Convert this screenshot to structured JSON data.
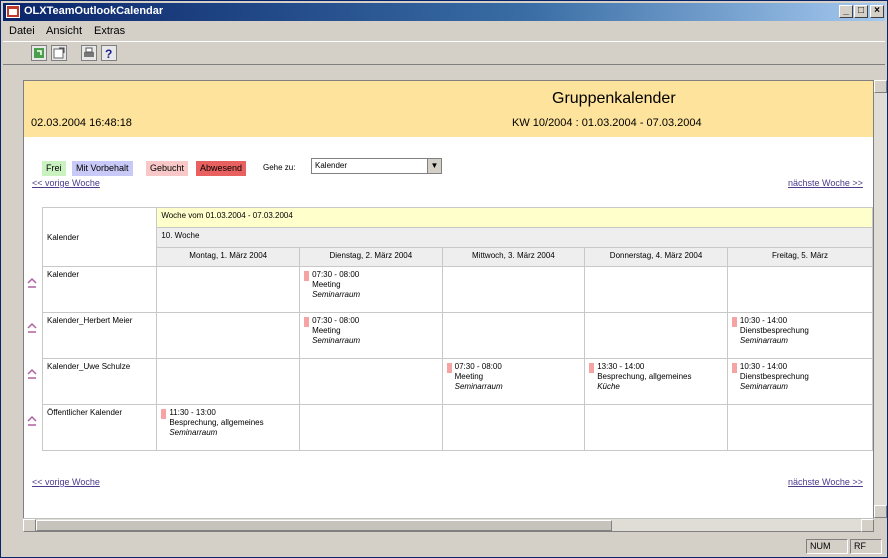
{
  "window": {
    "title": "OLXTeamOutlookCalendar",
    "controls": [
      "_",
      "□",
      "×"
    ]
  },
  "menu": {
    "items": [
      "Datei",
      "Ansicht",
      "Extras"
    ]
  },
  "header": {
    "datetime": "02.03.2004 16:48:18",
    "title": "Gruppenkalender",
    "week": "KW 10/2004 :  01.03.2004 - 07.03.2004"
  },
  "legend": {
    "items": [
      {
        "label": "Frei",
        "color": "#c9f2c0"
      },
      {
        "label": "Mit Vorbehalt",
        "color": "#c9c9f7"
      },
      {
        "label": "Gebucht",
        "color": "#f8c8c8"
      },
      {
        "label": "Abwesend",
        "color": "#e86060"
      }
    ]
  },
  "goto": {
    "label": "Gehe zu:",
    "selected": "Kalender"
  },
  "nav": {
    "prev": "<< vorige Woche",
    "next": "nächste Woche >>"
  },
  "calendar": {
    "column_header": "Kalender",
    "week_range": "Woche vom 01.03.2004 - 07.03.2004",
    "week_no": "10. Woche",
    "days": [
      "Montag, 1. März 2004",
      "Dienstag, 2. März 2004",
      "Mittwoch, 3. März 2004",
      "Donnerstag, 4. März 2004",
      "Freitag, 5. März"
    ],
    "rows": [
      {
        "name": "Kalender",
        "events": [
          null,
          {
            "time": "07:30 - 08:00",
            "subject": "Meeting",
            "location": "Seminarraum"
          },
          null,
          null,
          null
        ]
      },
      {
        "name": "Kalender_Herbert Meier",
        "events": [
          null,
          {
            "time": "07:30 - 08:00",
            "subject": "Meeting",
            "location": "Seminarraum"
          },
          null,
          null,
          {
            "time": "10:30 - 14:00",
            "subject": "Dienstbesprechung",
            "location": "Seminarraum"
          }
        ]
      },
      {
        "name": "Kalender_Uwe Schulze",
        "events": [
          null,
          null,
          {
            "time": "07:30 - 08:00",
            "subject": "Meeting",
            "location": "Seminarraum"
          },
          {
            "time": "13:30 - 14:00",
            "subject": "Besprechung, allgemeines",
            "location": "Küche"
          },
          {
            "time": "10:30 - 14:00",
            "subject": "Dienstbesprechung",
            "location": "Seminarraum"
          }
        ]
      },
      {
        "name": "Öffentlicher Kalender",
        "events": [
          {
            "time": "11:30 - 13:00",
            "subject": "Besprechung, allgemeines",
            "location": "Seminarraum"
          },
          null,
          null,
          null,
          null
        ]
      }
    ]
  },
  "status": {
    "num": "NUM",
    "rf": "RF"
  }
}
